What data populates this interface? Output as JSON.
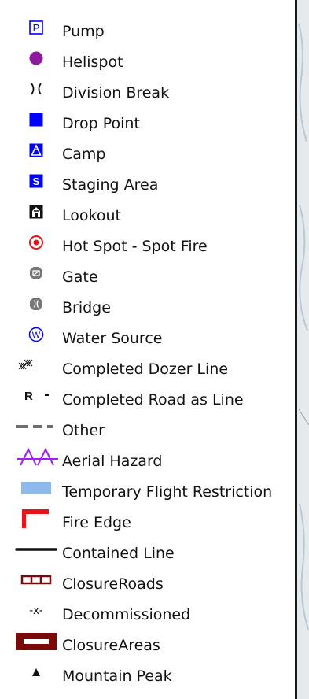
{
  "legend": {
    "items": [
      {
        "label": "Pump",
        "icon": "pump-icon"
      },
      {
        "label": "Helispot",
        "icon": "helispot-icon"
      },
      {
        "label": "Division Break",
        "icon": "division-break-icon"
      },
      {
        "label": "Drop Point",
        "icon": "drop-point-icon"
      },
      {
        "label": "Camp",
        "icon": "camp-icon"
      },
      {
        "label": "Staging Area",
        "icon": "staging-area-icon"
      },
      {
        "label": "Lookout",
        "icon": "lookout-icon"
      },
      {
        "label": "Hot Spot - Spot Fire",
        "icon": "hot-spot-icon"
      },
      {
        "label": "Gate",
        "icon": "gate-icon"
      },
      {
        "label": "Bridge",
        "icon": "bridge-icon"
      },
      {
        "label": "Water Source",
        "icon": "water-source-icon"
      },
      {
        "label": "Completed Dozer Line",
        "icon": "dozer-line-icon"
      },
      {
        "label": "Completed Road as Line",
        "icon": "road-line-icon"
      },
      {
        "label": "Other",
        "icon": "other-line-icon"
      },
      {
        "label": "Aerial Hazard",
        "icon": "aerial-hazard-icon"
      },
      {
        "label": "Temporary Flight Restriction",
        "icon": "tfr-icon"
      },
      {
        "label": "Fire Edge",
        "icon": "fire-edge-icon"
      },
      {
        "label": "Contained Line",
        "icon": "contained-line-icon"
      },
      {
        "label": "ClosureRoads",
        "icon": "closure-roads-icon"
      },
      {
        "label": "Decommissioned",
        "icon": "decommissioned-icon"
      },
      {
        "label": "ClosureAreas",
        "icon": "closure-areas-icon"
      },
      {
        "label": "Mountain Peak",
        "icon": "mountain-peak-icon"
      }
    ],
    "symbol_text": {
      "pump": "P",
      "staging": "S",
      "water": "W",
      "road": "R",
      "decommissioned": "-x-"
    }
  },
  "colors": {
    "blue": "#0000ff",
    "purple": "#8b1a9c",
    "red": "#e8141a",
    "dark_red": "#7a0a0a",
    "tfr": "#8fb8ec",
    "aerial": "#a020f0",
    "gray": "#6f6f6f"
  }
}
